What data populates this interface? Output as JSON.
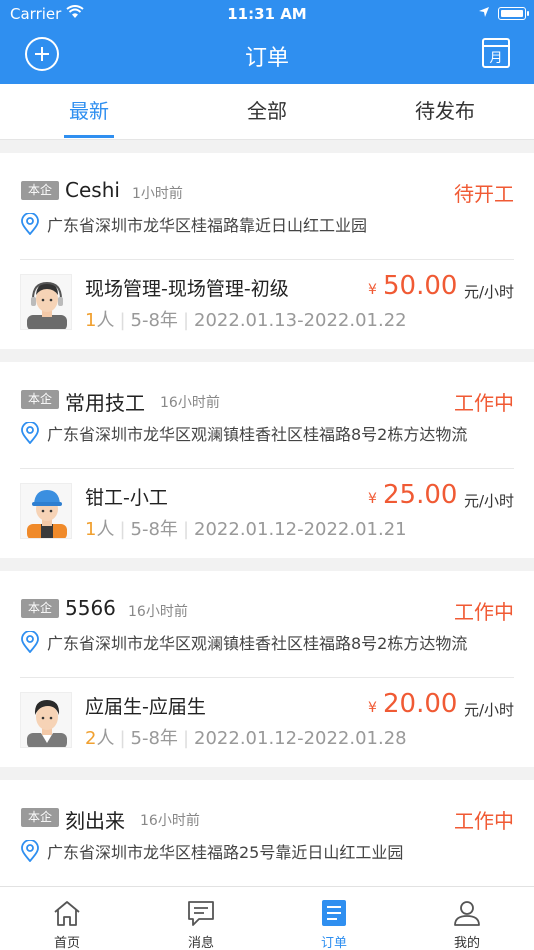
{
  "status": {
    "carrier": "Carrier",
    "time": "11:31 AM"
  },
  "nav": {
    "title": "订单",
    "calendar_label": "月"
  },
  "tabs": [
    {
      "label": "最新",
      "active": true
    },
    {
      "label": "全部",
      "active": false
    },
    {
      "label": "待发布",
      "active": false
    }
  ],
  "orders": [
    {
      "badge": "本企",
      "company": "Ceshi",
      "ago": "1小时前",
      "status": "待开工",
      "address": "广东省深圳市龙华区桂福路靠近日山红工业园",
      "job": "现场管理-现场管理-初级",
      "yen": "¥",
      "price": "50.00",
      "unit": "元/小时",
      "count_num": "1",
      "count_unit": "人",
      "experience": "5-8年",
      "dates": "2022.01.13-2022.01.22",
      "avatar": "manager-avatar-icon"
    },
    {
      "badge": "本企",
      "company": "常用技工",
      "ago": "16小时前",
      "status": "工作中",
      "address": "广东省深圳市龙华区观澜镇桂香社区桂福路8号2栋方达物流",
      "job": "钳工-小工",
      "yen": "¥",
      "price": "25.00",
      "unit": "元/小时",
      "count_num": "1",
      "count_unit": "人",
      "experience": "5-8年",
      "dates": "2022.01.12-2022.01.21",
      "avatar": "worker-avatar-icon"
    },
    {
      "badge": "本企",
      "company": "5566",
      "ago": "16小时前",
      "status": "工作中",
      "address": "广东省深圳市龙华区观澜镇桂香社区桂福路8号2栋方达物流",
      "job": "应届生-应届生",
      "yen": "¥",
      "price": "20.00",
      "unit": "元/小时",
      "count_num": "2",
      "count_unit": "人",
      "experience": "5-8年",
      "dates": "2022.01.12-2022.01.28",
      "avatar": "graduate-avatar-icon"
    },
    {
      "badge": "本企",
      "company": "刻出来",
      "ago": "16小时前",
      "status": "工作中",
      "address": "广东省深圳市龙华区桂福路25号靠近日山红工业园"
    }
  ],
  "tabbar": [
    {
      "label": "首页",
      "icon": "home-icon",
      "active": false
    },
    {
      "label": "消息",
      "icon": "message-icon",
      "active": false
    },
    {
      "label": "订单",
      "icon": "order-icon",
      "active": true
    },
    {
      "label": "我的",
      "icon": "profile-icon",
      "active": false
    }
  ],
  "colors": {
    "primary": "#2f8ff0",
    "accent": "#f05a34",
    "count": "#f0a030"
  }
}
